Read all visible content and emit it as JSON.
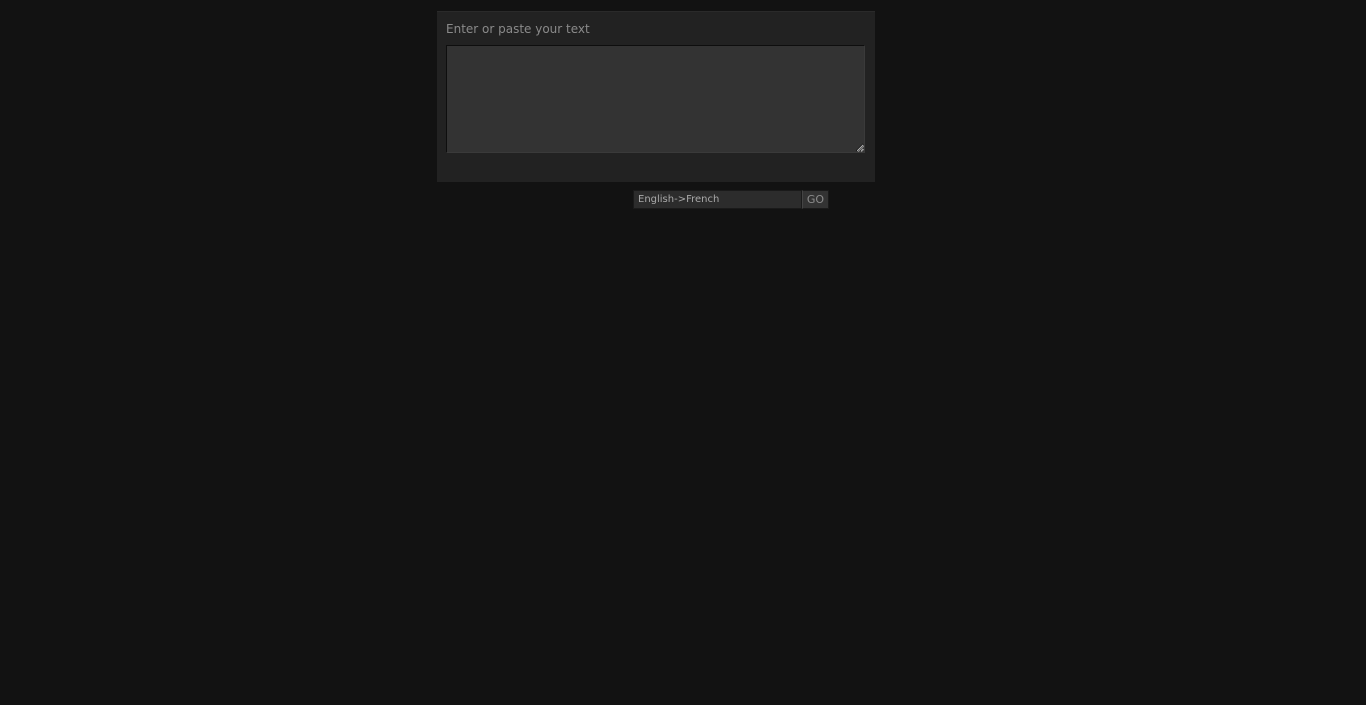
{
  "input_panel": {
    "label": "Enter or paste your text",
    "text_value": ""
  },
  "controls": {
    "language_pair": "English->French",
    "go_label": "GO"
  },
  "colors": {
    "background": "#121212",
    "panel": "#222222",
    "textarea": "#333333",
    "label_text": "#8a8a8a"
  }
}
